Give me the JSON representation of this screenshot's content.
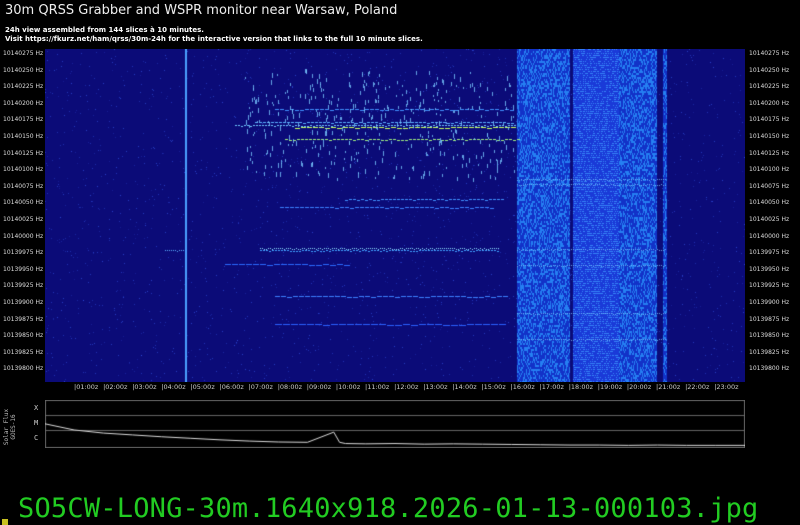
{
  "header": {
    "title": "30m QRSS Grabber and WSPR monitor near Warsaw, Poland",
    "line1": "24h view assembled from 144 slices à 10 minutes.",
    "line2": "Visit https://fkurz.net/ham/qrss/30m-24h for the interactive version that links to the full 10 minute slices."
  },
  "spectrogram": {
    "freq_labels": [
      "10140275 Hz",
      "10140250 Hz",
      "10140225 Hz",
      "10140200 Hz",
      "10140175 Hz",
      "10140150 Hz",
      "10140125 Hz",
      "10140100 Hz",
      "10140075 Hz",
      "10140050 Hz",
      "10140025 Hz",
      "10140000 Hz",
      "10139975 Hz",
      "10139950 Hz",
      "10139925 Hz",
      "10139900 Hz",
      "10139875 Hz",
      "10139850 Hz",
      "10139825 Hz",
      "10139800 Hz"
    ],
    "time_labels": [
      "01:00z",
      "02:00z",
      "03:00z",
      "04:00z",
      "05:00z",
      "06:00z",
      "07:00z",
      "08:00z",
      "09:00z",
      "10:00z",
      "11:00z",
      "12:00z",
      "13:00z",
      "14:00z",
      "15:00z",
      "16:00z",
      "17:00z",
      "18:00z",
      "19:00z",
      "20:00z",
      "21:00z",
      "22:00z",
      "23:00z"
    ],
    "colors": {
      "background": "#0b0b78",
      "signal": "#3fa0ff",
      "strong": "#c8ff60"
    }
  },
  "solar_flux": {
    "title": "Solar Flux",
    "source": "GOES-16",
    "levels": [
      "X",
      "M",
      "C"
    ],
    "curve_hours": [
      0,
      1,
      2,
      3,
      4,
      5,
      6,
      7,
      8,
      9,
      9.9,
      10.1,
      10.3,
      11,
      12,
      13,
      14,
      15,
      16,
      17,
      18,
      19,
      20,
      21,
      22,
      23,
      24
    ],
    "curve_level": [
      0.72,
      0.52,
      0.42,
      0.36,
      0.3,
      0.25,
      0.2,
      0.16,
      0.13,
      0.12,
      0.45,
      0.12,
      0.08,
      0.07,
      0.08,
      0.06,
      0.07,
      0.06,
      0.05,
      0.04,
      0.03,
      0.03,
      0.02,
      0.03,
      0.02,
      0.02,
      0.02
    ]
  },
  "footer": {
    "filename": "SO5CW-LONG-30m.1640x918.2026-01-13-000103.jpg"
  }
}
